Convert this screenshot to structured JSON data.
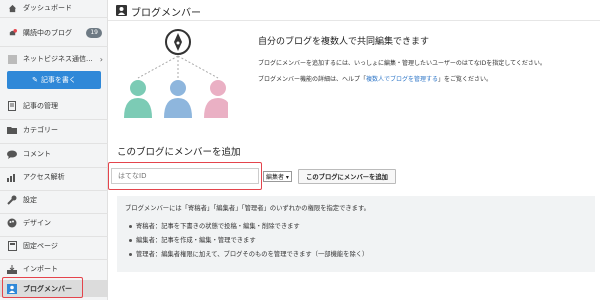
{
  "sidebar": {
    "dashboard": "ダッシュボード",
    "reading": "購読中のブログ",
    "reading_count": "19",
    "blog_name": "ネットビジネス通信...",
    "write_button": "記事を書く",
    "items": [
      {
        "label": "記事の管理",
        "icon": "document-icon"
      },
      {
        "label": "カテゴリー",
        "icon": "folder-icon"
      },
      {
        "label": "コメント",
        "icon": "comment-icon"
      },
      {
        "label": "アクセス解析",
        "icon": "chart-icon"
      },
      {
        "label": "設定",
        "icon": "wrench-icon"
      },
      {
        "label": "デザイン",
        "icon": "palette-icon"
      },
      {
        "label": "固定ページ",
        "icon": "page-icon"
      },
      {
        "label": "インポート",
        "icon": "import-icon"
      },
      {
        "label": "ブログメンバー",
        "icon": "members-icon"
      }
    ]
  },
  "main": {
    "title": "ブログメンバー",
    "info_title": "自分のブログを複数人で共同編集できます",
    "info_p1": "ブログにメンバーを追加するには、いっしょに編集・管理したいユーザーのはてなIDを指定してください。",
    "info_p2_pre": "ブログメンバー機能の詳細は、ヘルプ「",
    "info_p2_link": "複数人でブログを管理する",
    "info_p2_post": "」をご覧ください。",
    "form_title": "このブログにメンバーを追加",
    "id_placeholder": "はてなID",
    "role_selected": "編集者 ▾",
    "add_button": "このブログにメンバーを追加",
    "note_intro": "ブログメンバーには「寄稿者」「編集者」「管理者」のいずれかの権限を指定できます。",
    "note_items": [
      "寄稿者：記事を下書きの状態で投稿・編集・削除できます",
      "編集者：記事を作成・編集・管理できます",
      "管理者：編集者権限に加えて、ブログそのものを管理できます（一部機能を除く）"
    ]
  },
  "colors": {
    "accent": "#2f88d8",
    "highlight": "#e4444c",
    "person_green": "#7ccbb5",
    "person_blue": "#8eb6dd",
    "person_pink": "#eab0c4"
  }
}
